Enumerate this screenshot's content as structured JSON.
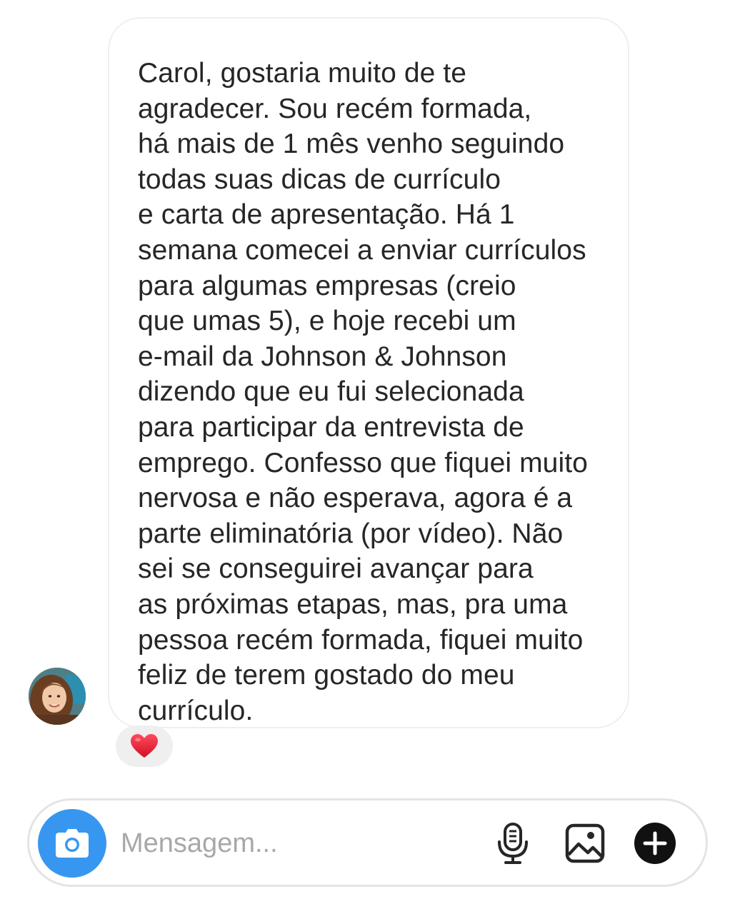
{
  "conversation": {
    "message": {
      "text": "Carol, gostaria muito de te\nagradecer. Sou recém formada,\nhá mais de 1 mês venho seguindo\ntodas suas dicas de currículo\ne carta de apresentação. Há 1\nsemana comecei a enviar currículos\npara algumas empresas (creio\nque umas 5), e hoje recebi um\ne-mail da Johnson & Johnson\ndizendo que eu fui selecionada\npara participar da entrevista de\nemprego. Confesso que fiquei muito\nnervosa e não esperava, agora é a\nparte eliminatória (por vídeo). Não\nsei se conseguirei avançar para\nas próximas etapas, mas, pra uma\npessoa recém formada, fiquei muito\nfeliz de terem gostado do meu\ncurrículo.",
      "reaction": "heart"
    }
  },
  "composer": {
    "placeholder": "Mensagem...",
    "value": "",
    "icons": {
      "camera": "camera-icon",
      "mic": "microphone-icon",
      "gallery": "gallery-icon",
      "plus": "plus-icon"
    }
  },
  "colors": {
    "accent": "#3797f0",
    "text": "#262626",
    "placeholder": "#a8a8a8",
    "bubble_border": "#efefef",
    "reaction_bg": "#efefef",
    "heart": "#e8192c"
  }
}
